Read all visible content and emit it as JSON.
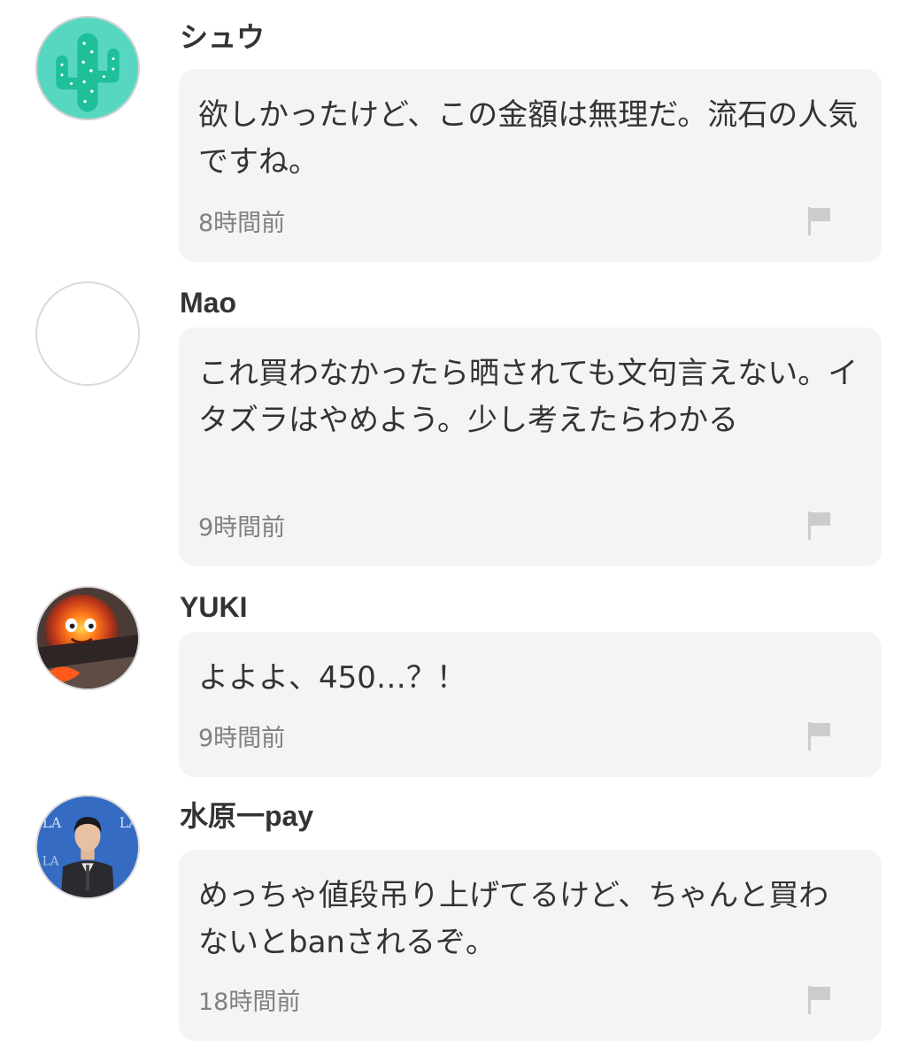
{
  "comments": [
    {
      "username": "シュウ",
      "text": "欲しかったけど、この金額は無理だ。流石の人気ですね。",
      "time": "8時間前",
      "avatar_icon": "cactus-avatar"
    },
    {
      "username": "Mao",
      "text": "これ買わなかったら晒されても文句言えない。イタズラはやめよう。少し考えたらわかる",
      "time": "9時間前",
      "avatar_icon": "blank-avatar"
    },
    {
      "username": "YUKI",
      "text": "よよよ、450…？！",
      "time": "9時間前",
      "avatar_icon": "fire-demon-avatar"
    },
    {
      "username": "水原一pay",
      "text": "めっちゃ値段吊り上げてるけど、ちゃんと買わないとbanされるぞ。",
      "time": "18時間前",
      "avatar_icon": "person-photo-avatar"
    }
  ],
  "colors": {
    "bubble": "#f4f4f4",
    "text": "#333333",
    "time": "#808080",
    "flag": "#cccccc",
    "cactus_bg": "#58d7c0"
  },
  "flag_icon": "flag-icon"
}
